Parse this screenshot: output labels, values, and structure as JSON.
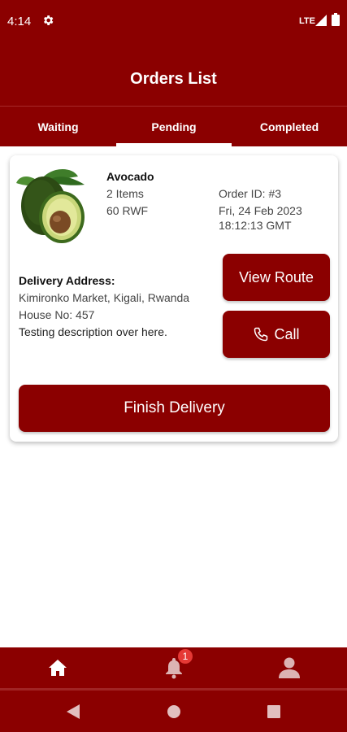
{
  "status_bar": {
    "time": "4:14",
    "network": "LTE",
    "icons": [
      "gear-icon",
      "signal-icon",
      "battery-icon"
    ]
  },
  "header": {
    "title": "Orders List"
  },
  "tabs": [
    {
      "label": "Waiting",
      "selected": false
    },
    {
      "label": "Pending",
      "selected": true
    },
    {
      "label": "Completed",
      "selected": false
    }
  ],
  "order": {
    "image_icon": "avocado-image",
    "product_name": "Avocado",
    "quantity": "2 Items",
    "price": "60 RWF",
    "order_id": "Order ID: #3",
    "date": "Fri, 24 Feb 2023",
    "time": "18:12:13 GMT",
    "delivery_label": "Delivery Address:",
    "address": "Kimironko Market, Kigali, Rwanda",
    "house": "House No: 457",
    "description": "Testing description over here."
  },
  "buttons": {
    "view_route": "View Route",
    "call": "Call",
    "finish_delivery": "Finish Delivery"
  },
  "bottom_nav": {
    "items": [
      "home-icon",
      "bell-icon",
      "person-icon"
    ],
    "notification_count": "1"
  },
  "system_nav": [
    "back-icon",
    "home-circle-icon",
    "recents-icon"
  ],
  "colors": {
    "primary": "#8b0000",
    "badge": "#e53935",
    "background": "#ffffff"
  }
}
